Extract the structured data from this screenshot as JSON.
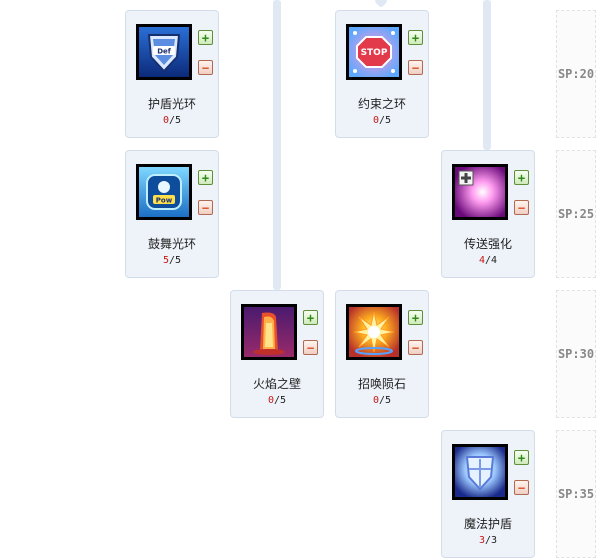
{
  "skills": [
    {
      "name": "护盾光环",
      "current": "0",
      "max": "5"
    },
    {
      "name": "约束之环",
      "current": "0",
      "max": "5"
    },
    {
      "name": "鼓舞光环",
      "current": "5",
      "max": "5"
    },
    {
      "name": "传送强化",
      "current": "4",
      "max": "4"
    },
    {
      "name": "火焰之壁",
      "current": "0",
      "max": "5"
    },
    {
      "name": "招唤陨石",
      "current": "0",
      "max": "5"
    },
    {
      "name": "魔法护盾",
      "current": "3",
      "max": "3"
    }
  ],
  "buttons": {
    "plus": "+",
    "minus": "−"
  },
  "level_separator": "/",
  "sp_requirements": [
    "SP:20",
    "SP:25",
    "SP:30",
    "SP:35"
  ],
  "icons": {
    "shield_aura": "def-shield-icon",
    "restraint_ring": "stop-sign-icon",
    "inspire_aura": "pow-emblem-icon",
    "teleport_boost": "teleport-sparkle-icon",
    "fire_wall": "fire-pillar-icon",
    "meteor": "meteor-burst-icon",
    "magic_shield": "magic-shield-icon"
  },
  "colors": {
    "node_bg": "#eef3fa",
    "current_level": "#c81818",
    "sp_text": "#888888"
  }
}
